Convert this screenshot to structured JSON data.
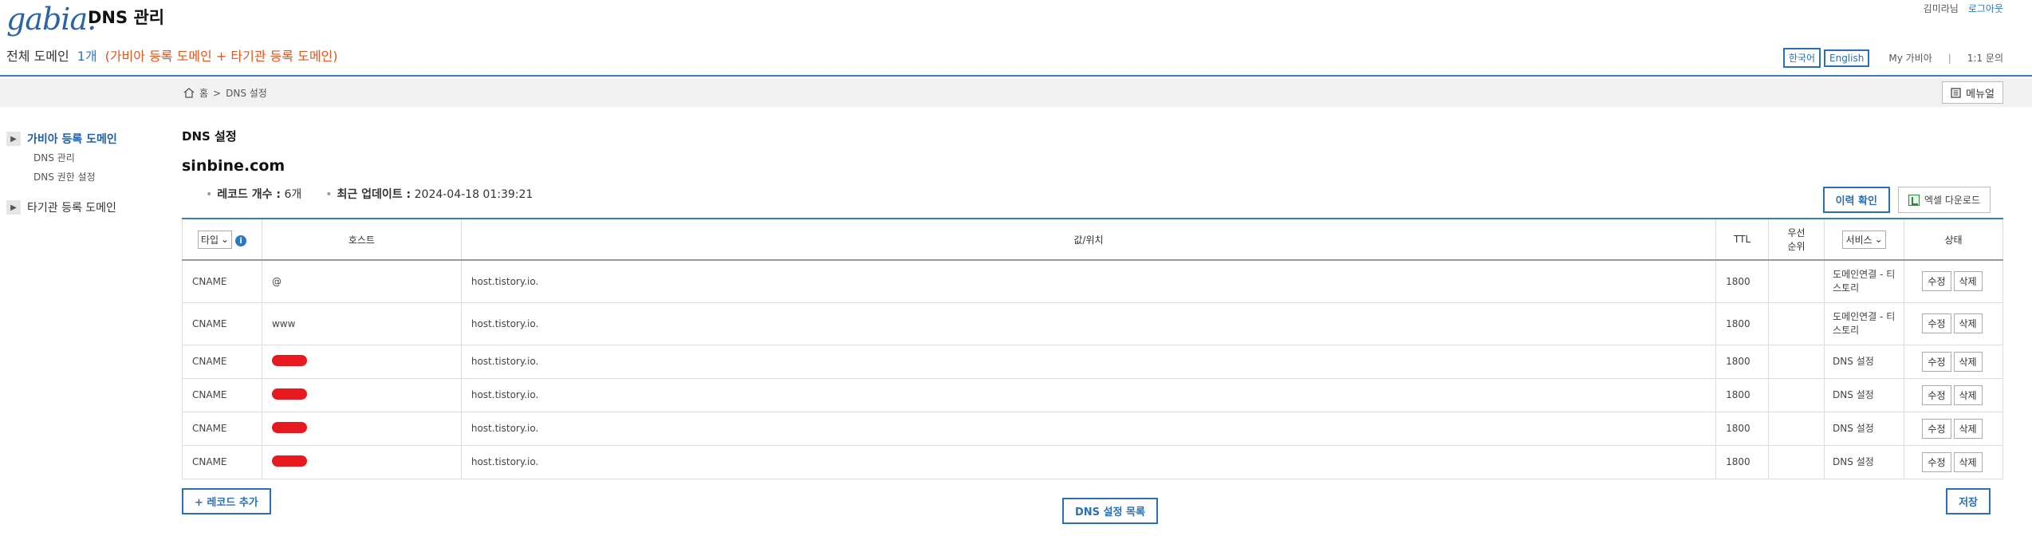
{
  "header": {
    "logo": "gabia.",
    "app_title": "DNS 관리",
    "summary_label": "전체 도메인",
    "summary_count": "1개",
    "summary_note": "(가비아 등록 도메인 + 타기관 등록 도메인)",
    "user_name": "김미라님",
    "logout": "로그아웃",
    "lang_ko": "한국어",
    "lang_en": "English",
    "my_gabia": "My 가비아",
    "separator": "|",
    "inquiry": "1:1 문의"
  },
  "breadcrumb": {
    "home": "홈",
    "sep": ">",
    "current": "DNS 설정"
  },
  "manual_button": "메뉴얼",
  "sidebar": {
    "section1": "가비아 등록 도메인",
    "sub1": "DNS 관리",
    "sub2": "DNS 권한 설정",
    "section2": "타기관 등록 도메인"
  },
  "main": {
    "page_title": "DNS 설정",
    "domain": "sinbine.com",
    "record_count_label": "레코드 개수 :",
    "record_count": "6개",
    "updated_label": "최근 업데이트 :",
    "updated_value": "2024-04-18 01:39:21",
    "history_button": "이력 확인",
    "excel_button": "엑셀 다운로드"
  },
  "table": {
    "col_type": "타입",
    "col_host": "호스트",
    "col_value": "값/위치",
    "col_ttl": "TTL",
    "col_priority_1": "우선",
    "col_priority_2": "순위",
    "col_service": "서비스",
    "col_status": "상태",
    "rows": [
      {
        "type": "CNAME",
        "host": "@",
        "value": "host.tistory.io.",
        "ttl": "1800",
        "priority": "",
        "service": "도메인연결 - 티스토리",
        "redacted": false
      },
      {
        "type": "CNAME",
        "host": "www",
        "value": "host.tistory.io.",
        "ttl": "1800",
        "priority": "",
        "service": "도메인연결 - 티스토리",
        "redacted": false
      },
      {
        "type": "CNAME",
        "host": "",
        "value": "host.tistory.io.",
        "ttl": "1800",
        "priority": "",
        "service": "DNS 설정",
        "redacted": true
      },
      {
        "type": "CNAME",
        "host": "",
        "value": "host.tistory.io.",
        "ttl": "1800",
        "priority": "",
        "service": "DNS 설정",
        "redacted": true
      },
      {
        "type": "CNAME",
        "host": "",
        "value": "host.tistory.io.",
        "ttl": "1800",
        "priority": "",
        "service": "DNS 설정",
        "redacted": true
      },
      {
        "type": "CNAME",
        "host": "",
        "value": "host.tistory.io.",
        "ttl": "1800",
        "priority": "",
        "service": "DNS 설정",
        "redacted": true
      }
    ],
    "edit_label": "수정",
    "delete_label": "삭제"
  },
  "footer": {
    "add_record": "+ 레코드 추가",
    "dns_list": "DNS 설정 목록",
    "save": "저장"
  },
  "colors": {
    "accent": "#2b6fb4",
    "note": "#e0561d",
    "redaction": "#e8191e"
  }
}
